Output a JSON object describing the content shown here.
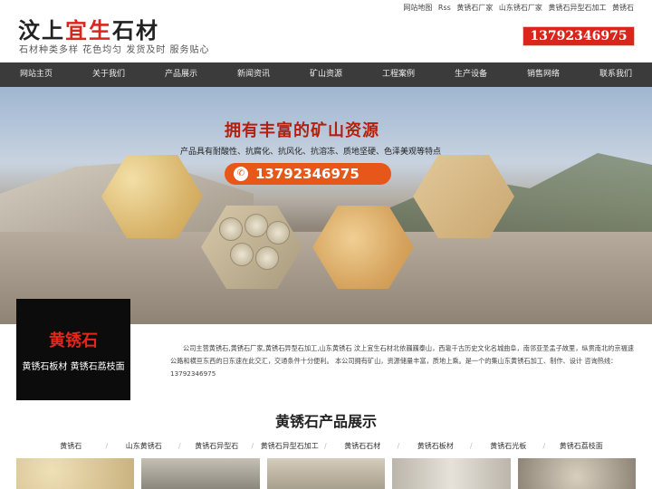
{
  "header": {
    "logo_part1": "汶上",
    "logo_part2": "宜生",
    "logo_part3": "石材",
    "tagline": "石材种类多样 花色均匀 发货及时 服务贴心",
    "toplinks": [
      "网站地图",
      "Rss",
      "黄锈石厂家",
      "山东锈石厂家",
      "黄锈石异型石加工",
      "黄锈石"
    ],
    "phone": "13792346975"
  },
  "nav": {
    "items": [
      "网站主页",
      "关于我们",
      "产品展示",
      "新闻资讯",
      "矿山资源",
      "工程案例",
      "生产设备",
      "销售网络",
      "联系我们"
    ]
  },
  "banner": {
    "title": "拥有丰富的矿山资源",
    "subtitle": "产品具有耐酸性、抗腐化、抗风化、抗溶冻、质地坚硬、色泽美观等特点",
    "phone": "13792346975"
  },
  "intro": {
    "image_title": "黄锈石",
    "image_subtitle": "黄锈石板材 黄锈石荔枝面",
    "text": "公司主营黄锈石,黄锈石厂家,黄锈石异型石加工,山东黄锈石 汶上宜生石材北依巍巍泰山，西靠千古历史文化名城曲阜，南邻亚圣孟子故里，纵贯南北的京福速公路和横亘东西的日东速在此交汇，交通条件十分便利。 本公司拥有矿山，资源储量丰富，质地上乘。是一个的集山东黄锈石加工、制作、设计 咨询热线：13792346975"
  },
  "products": {
    "title": "黄锈石产品展示",
    "tabs": [
      "黄锈石",
      "山东黄锈石",
      "黄锈石异型石",
      "黄锈石异型石加工",
      "黄锈石石材",
      "黄锈石板材",
      "黄锈石光板",
      "黄锈石荔枝面"
    ]
  },
  "colors": {
    "brand_red": "#d9261c",
    "nav_bg": "#3b3b3b",
    "banner_phone": "#e8571a"
  }
}
